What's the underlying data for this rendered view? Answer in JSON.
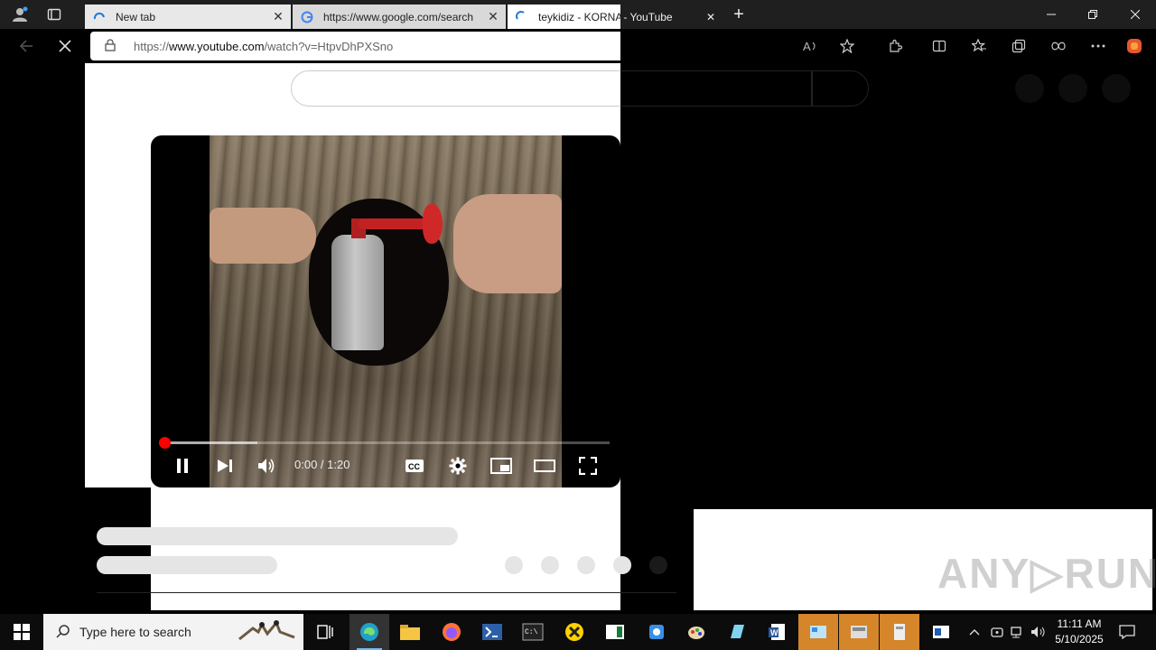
{
  "browser": {
    "tabs": [
      {
        "label": "New tab",
        "favicon": "edge-newtab-icon",
        "active": false
      },
      {
        "label": "https://www.google.com/search",
        "favicon": "google-g-icon",
        "active": false
      },
      {
        "label": "teykidiz - KORNA - YouTube",
        "favicon": "loading-spinner-icon",
        "active": true
      }
    ],
    "tab_close_glyph": "✕",
    "new_tab_glyph": "+",
    "address": {
      "scheme": "https://",
      "host": "www.youtube.com",
      "path": "/watch?v=HtpvDhPXSno"
    }
  },
  "player": {
    "time_display": "0:00 / 1:20",
    "progress_played_fraction": 0.0,
    "buffered_fraction": 0.21
  },
  "taskbar": {
    "search_placeholder": "Type here to search",
    "clock_time": "11:11 AM",
    "clock_date": "5/10/2025"
  },
  "watermark": "ANY RUN",
  "colors": {
    "progress_red": "#ff0000",
    "taskbar_bg": "#0c0c0c",
    "titlebar_bg": "#1f1f1f"
  }
}
